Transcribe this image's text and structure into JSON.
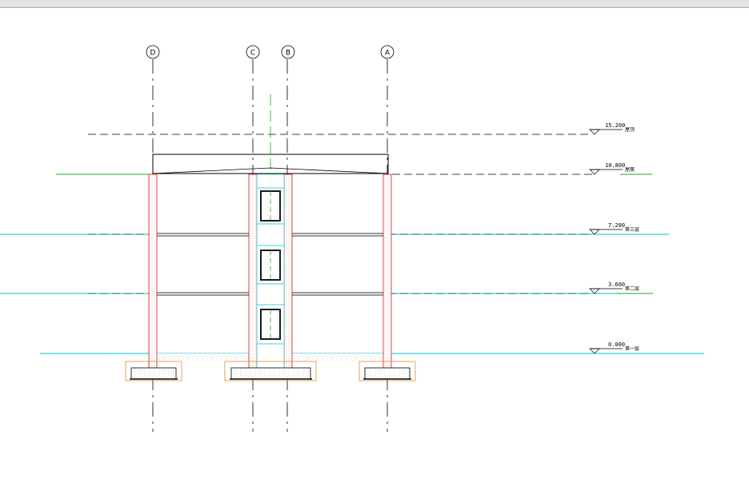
{
  "axes": [
    {
      "label": "D"
    },
    {
      "label": "C"
    },
    {
      "label": "B"
    },
    {
      "label": "A"
    }
  ],
  "levels": [
    {
      "elevation": "15.200",
      "name": "屋顶"
    },
    {
      "elevation": "10.800",
      "name": "屋面"
    },
    {
      "elevation": "7.200",
      "name": "第三层"
    },
    {
      "elevation": "3.600",
      "name": "第二层"
    },
    {
      "elevation": "0.000",
      "name": "第一层"
    }
  ],
  "colors": {
    "background": "#ffffff",
    "column_outline": "#cc2222",
    "column_hatch": "#ee9999",
    "level_cyan": "#00c0d0",
    "level_green": "#22aa22",
    "stair_green": "#22aa22",
    "footing_outline": "#e09030",
    "line_black": "#000000"
  }
}
